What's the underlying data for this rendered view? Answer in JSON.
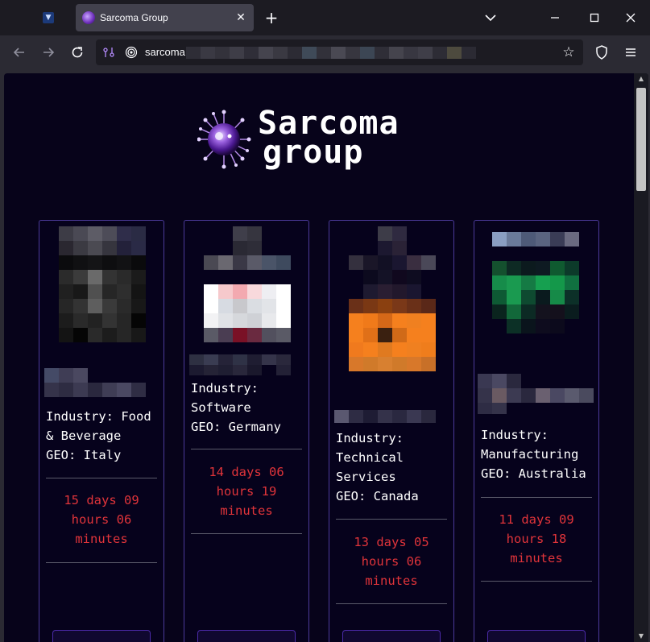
{
  "browser": {
    "tab_title": "Sarcoma Group",
    "close_symbol": "✕",
    "new_tab_symbol": "+",
    "url_text": "sarcoma",
    "icons": [
      "tab-list-chevron",
      "minimize",
      "maximize",
      "close",
      "back",
      "forward",
      "reload",
      "permissions",
      "lock",
      "bookmark-star",
      "shield",
      "menu"
    ]
  },
  "site": {
    "logo_line1": "Sarcoma",
    "logo_line2": "group",
    "accent_color": "#e0343a",
    "border_color": "#4b3a9a"
  },
  "victims": [
    {
      "industry_label": "Industry: Food",
      "industry_cont": "& Beverage",
      "geo": "GEO: Italy",
      "timer_l1": "15 days 09",
      "timer_l2": "hours 06",
      "timer_l3": "minutes"
    },
    {
      "industry_label": "Industry:",
      "industry_cont": "Software",
      "geo": "GEO: Germany",
      "timer_l1": "14 days 06",
      "timer_l2": "hours 19",
      "timer_l3": "minutes"
    },
    {
      "industry_label": "Industry:",
      "industry_cont": "Technical",
      "industry_cont2": "Services",
      "geo": "GEO: Canada",
      "timer_l1": "13 days 05",
      "timer_l2": "hours 06",
      "timer_l3": "minutes"
    },
    {
      "industry_label": "Industry:",
      "industry_cont": "Manufacturing",
      "geo": "GEO: Australia",
      "timer_l1": "11 days 09",
      "timer_l2": "hours 18",
      "timer_l3": "minutes"
    }
  ]
}
